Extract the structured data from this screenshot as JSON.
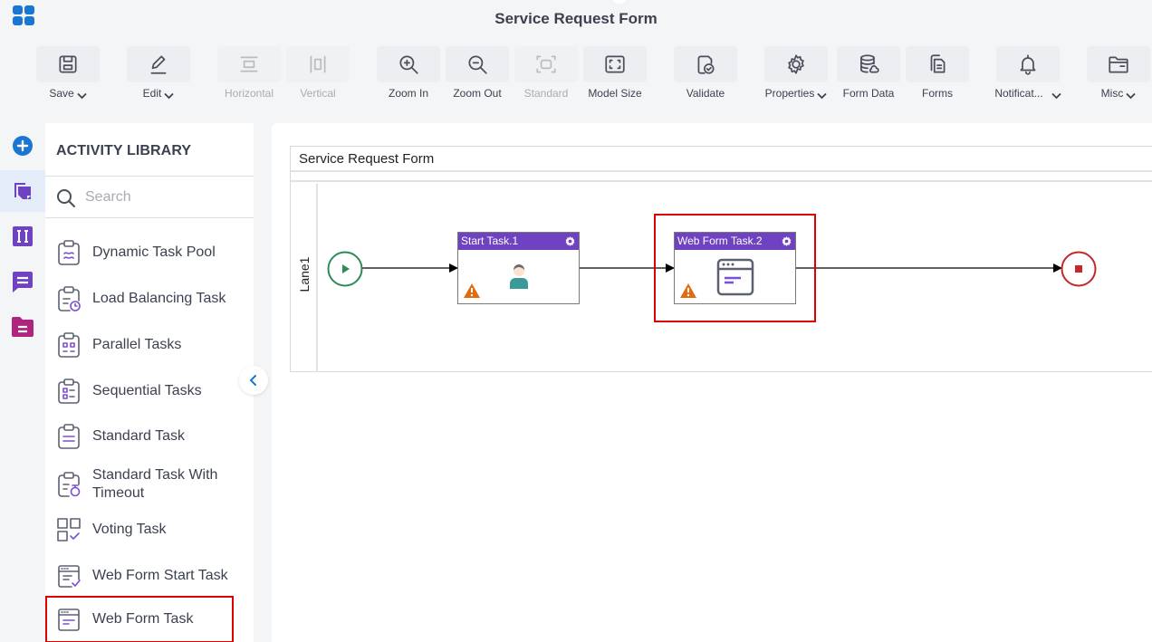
{
  "header": {
    "title": "Service Request Form"
  },
  "toolbar": {
    "buttons": [
      {
        "label": "Save",
        "icon": "save-icon",
        "dropdown": true,
        "enabled": true
      },
      {
        "label": "Edit",
        "icon": "pencil-icon",
        "dropdown": true,
        "enabled": true
      },
      {
        "label": "Horizontal",
        "icon": "horizontal-layout-icon",
        "dropdown": false,
        "enabled": false
      },
      {
        "label": "Vertical",
        "icon": "vertical-layout-icon",
        "dropdown": false,
        "enabled": false
      },
      {
        "label": "Zoom In",
        "icon": "zoom-in-icon",
        "dropdown": false,
        "enabled": true
      },
      {
        "label": "Zoom Out",
        "icon": "zoom-out-icon",
        "dropdown": false,
        "enabled": true
      },
      {
        "label": "Standard",
        "icon": "standard-size-icon",
        "dropdown": false,
        "enabled": false
      },
      {
        "label": "Model Size",
        "icon": "model-size-icon",
        "dropdown": false,
        "enabled": true
      },
      {
        "label": "Validate",
        "icon": "validate-icon",
        "dropdown": false,
        "enabled": true
      },
      {
        "label": "Properties",
        "icon": "gear-icon",
        "dropdown": true,
        "enabled": true
      },
      {
        "label": "Form Data",
        "icon": "database-icon",
        "dropdown": false,
        "enabled": true
      },
      {
        "label": "Forms",
        "icon": "forms-icon",
        "dropdown": false,
        "enabled": true
      },
      {
        "label": "Notificat...",
        "icon": "bell-icon",
        "dropdown": true,
        "enabled": true
      },
      {
        "label": "Misc",
        "icon": "folder-icon",
        "dropdown": true,
        "enabled": true
      }
    ]
  },
  "rail": {
    "items": [
      {
        "name": "add",
        "icon": "plus-circle-icon",
        "active": false
      },
      {
        "name": "activity-library",
        "icon": "library-icon",
        "active": true
      },
      {
        "name": "variables",
        "icon": "variables-icon",
        "active": false
      },
      {
        "name": "comments",
        "icon": "comment-icon",
        "active": false
      },
      {
        "name": "documents",
        "icon": "document-folder-icon",
        "active": false
      }
    ]
  },
  "library": {
    "title": "ACTIVITY LIBRARY",
    "search_placeholder": "Search",
    "search_value": "",
    "items": [
      {
        "label": "Dynamic Task Pool",
        "icon": "dynamic-task-pool-icon"
      },
      {
        "label": "Load Balancing Task",
        "icon": "load-balancing-task-icon"
      },
      {
        "label": "Parallel Tasks",
        "icon": "parallel-tasks-icon"
      },
      {
        "label": "Sequential Tasks",
        "icon": "sequential-tasks-icon"
      },
      {
        "label": "Standard Task",
        "icon": "standard-task-icon"
      },
      {
        "label": "Standard Task With Timeout",
        "icon": "standard-task-timeout-icon"
      },
      {
        "label": "Voting Task",
        "icon": "voting-task-icon"
      },
      {
        "label": "Web Form Start Task",
        "icon": "web-form-start-task-icon"
      },
      {
        "label": "Web Form Task",
        "icon": "web-form-task-icon",
        "highlighted": true
      }
    ]
  },
  "canvas": {
    "pool_title": "Service Request Form",
    "lane_label": "Lane1",
    "nodes": [
      {
        "type": "start-event",
        "label": ""
      },
      {
        "type": "task",
        "label": "Start Task.1",
        "icon": "user-icon",
        "warning": true
      },
      {
        "type": "task",
        "label": "Web Form Task.2",
        "icon": "web-form-icon",
        "warning": true,
        "selected": true
      },
      {
        "type": "end-event",
        "label": ""
      }
    ]
  },
  "colors": {
    "accent": "#1976d2",
    "task_header": "#6f42c1",
    "start_event": "#2e8b57",
    "end_event": "#c62828",
    "warning": "#e06b12",
    "highlight": "#e00000"
  }
}
